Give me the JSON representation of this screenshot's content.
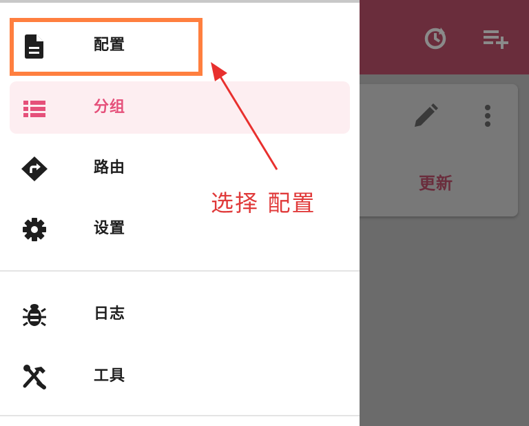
{
  "drawer": {
    "items": [
      {
        "label": "配置",
        "icon": "file-document-icon",
        "active": false
      },
      {
        "label": "分组",
        "icon": "list-icon",
        "active": true
      },
      {
        "label": "路由",
        "icon": "route-diamond-icon",
        "active": false
      },
      {
        "label": "设置",
        "icon": "gear-icon",
        "active": false
      },
      {
        "label": "日志",
        "icon": "bug-icon",
        "active": false
      },
      {
        "label": "工具",
        "icon": "tools-icon",
        "active": false
      }
    ]
  },
  "background": {
    "app_bar_icons": [
      "history-icon",
      "playlist-add-icon"
    ],
    "card": {
      "update_label": "更新"
    }
  },
  "annotation": {
    "text": "选择 配置"
  },
  "colors": {
    "accent": "#e5507a",
    "active_bg": "#fdeef1",
    "highlight_box": "#ff7f3f",
    "annotation": "#e03a3a",
    "app_bar": "#6a2d3c",
    "scrim": "#6b6b6b"
  }
}
